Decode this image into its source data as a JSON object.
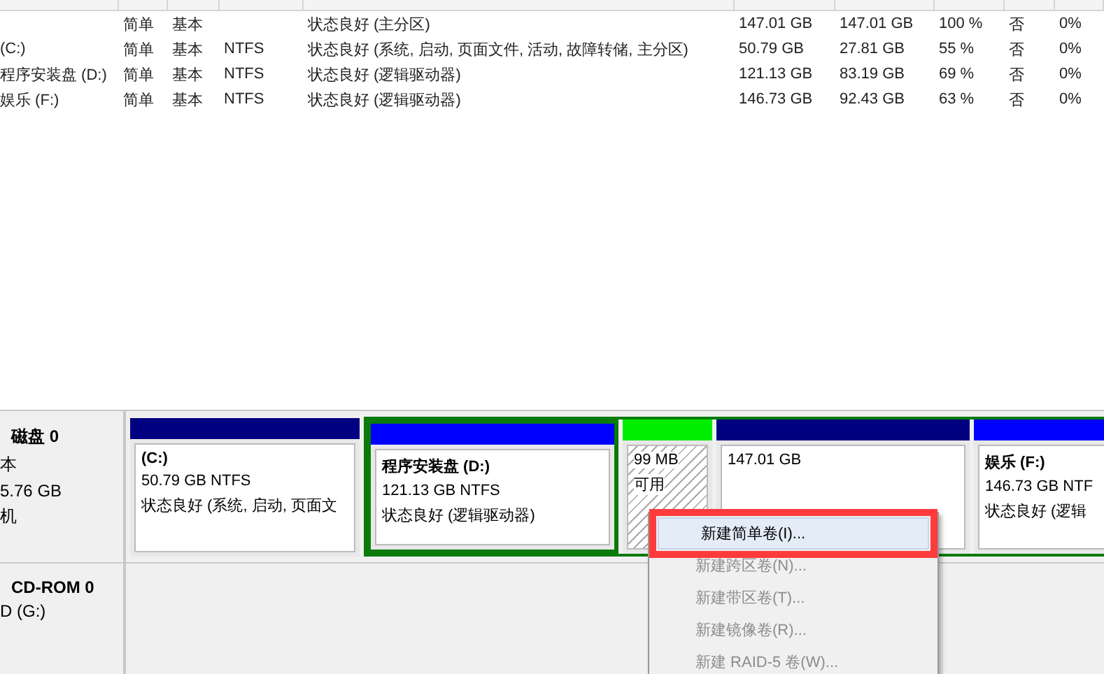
{
  "volume_table": {
    "rows": [
      {
        "cells": [
          "",
          "简单",
          "基本",
          "",
          "状态良好 (主分区)",
          "147.01 GB",
          "147.01 GB",
          "100 %",
          "否",
          "0%"
        ]
      },
      {
        "cells": [
          "(C:)",
          "简单",
          "基本",
          "NTFS",
          "状态良好 (系统, 启动, 页面文件, 活动, 故障转储, 主分区)",
          "50.79 GB",
          "27.81 GB",
          "55 %",
          "否",
          "0%"
        ]
      },
      {
        "cells": [
          "程序安装盘 (D:)",
          "简单",
          "基本",
          "NTFS",
          "状态良好 (逻辑驱动器)",
          "121.13 GB",
          "83.19 GB",
          "69 %",
          "否",
          "0%"
        ]
      },
      {
        "cells": [
          "娱乐 (F:)",
          "简单",
          "基本",
          "NTFS",
          "状态良好 (逻辑驱动器)",
          "146.73 GB",
          "92.43 GB",
          "63 %",
          "否",
          "0%"
        ]
      }
    ]
  },
  "disks": [
    {
      "title": "磁盘 0",
      "lines": [
        "本",
        "5.76 GB",
        "机"
      ],
      "partitions": [
        {
          "kind": "primary",
          "name": "(C:)",
          "lines": [
            "50.79 GB NTFS",
            "状态良好 (系统, 启动, 页面文"
          ],
          "selected": false,
          "in_extended": false
        },
        {
          "kind": "logical",
          "name": "程序安装盘 (D:)",
          "lines": [
            "121.13 GB NTFS",
            "状态良好 (逻辑驱动器)"
          ],
          "selected": true,
          "in_extended": true
        },
        {
          "kind": "free",
          "lines": [
            "99 MB",
            "可用"
          ],
          "selected": false,
          "in_extended": true
        },
        {
          "kind": "primary",
          "lines": [
            "147.01 GB"
          ],
          "selected": false,
          "in_extended": true
        },
        {
          "kind": "logical",
          "name": "娱乐 (F:)",
          "lines": [
            "146.73 GB NTF",
            "状态良好 (逻辑"
          ],
          "selected": false,
          "in_extended": true
        }
      ]
    },
    {
      "title": "CD-ROM 0",
      "lines": [
        "D (G:)"
      ]
    }
  ],
  "context_menu": {
    "items": [
      {
        "label": "新建简单卷(I)...",
        "disabled": false,
        "highlighted": true
      },
      {
        "label": "新建跨区卷(N)...",
        "disabled": true,
        "highlighted": false
      },
      {
        "label": "新建带区卷(T)...",
        "disabled": true,
        "highlighted": false
      },
      {
        "label": "新建镜像卷(R)...",
        "disabled": true,
        "highlighted": false
      },
      {
        "label": "新建 RAID-5 卷(W)...",
        "disabled": true,
        "highlighted": false
      }
    ]
  }
}
